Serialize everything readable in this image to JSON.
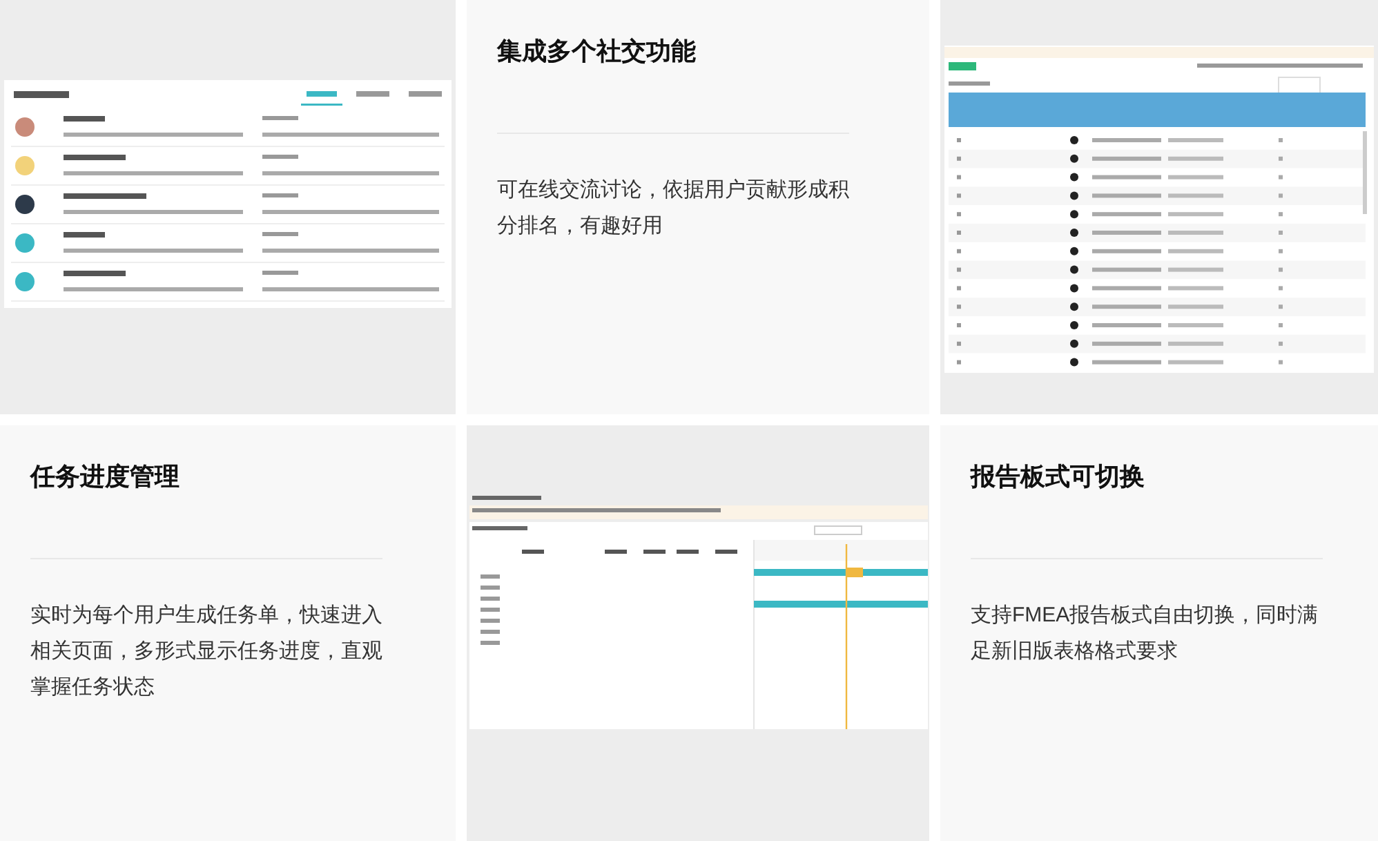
{
  "tiles": [
    {
      "kind": "ranking_screenshot"
    },
    {
      "kind": "text",
      "title": "集成多个社交功能",
      "body": "可在线交流讨论，依据用户贡献形成积分排名，有趣好用"
    },
    {
      "kind": "table_screenshot"
    },
    {
      "kind": "text",
      "title": "任务进度管理",
      "body": "实时为每个用户生成任务单，快速进入相关页面，多形式显示任务进度，直观掌握任务状态"
    },
    {
      "kind": "gantt_screenshot"
    },
    {
      "kind": "text",
      "title": "报告板式可切换",
      "body": "支持FMEA报告板式自由切换，同时满足新旧版表格格式要求"
    }
  ]
}
